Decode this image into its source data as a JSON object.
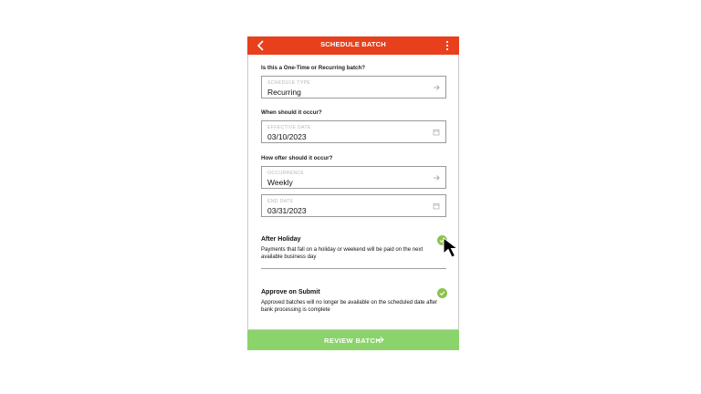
{
  "header": {
    "title": "SCHEDULE BATCH",
    "back_icon": "chevron-left-icon",
    "menu_icon": "more-vertical-icon",
    "color": "#e8401c"
  },
  "form": {
    "q1": "Is this a One-Time or Recurring batch?",
    "schedule_type": {
      "label": "SCHEDULE TYPE",
      "value": "Recurring",
      "icon": "arrow-right-icon"
    },
    "q2": "When should it occur?",
    "effective_date": {
      "label": "EFFECTIVE DATE",
      "value": "03/10/2023",
      "icon": "calendar-icon"
    },
    "q3": "How ofter should it occur?",
    "occurrence": {
      "label": "OCCURRENCE",
      "value": "Weekly",
      "icon": "arrow-right-icon"
    },
    "end_date": {
      "label": "END DATE",
      "value": "03/31/2023",
      "icon": "calendar-icon"
    }
  },
  "options": {
    "after_holiday": {
      "title": "After Holiday",
      "description": "Payments that fall on a holiday or weekend will be paid on the next available business day",
      "checked": true
    },
    "approve_on_submit": {
      "title": "Approve on Submit",
      "description": "Approved batches will no longer be available on the scheduled date after bank processing is complete",
      "checked": true
    }
  },
  "footer": {
    "button_label": "REVIEW BATCH",
    "color": "#8bd36b"
  },
  "colors": {
    "accent_red": "#e8401c",
    "check_green": "#8bc34a"
  }
}
